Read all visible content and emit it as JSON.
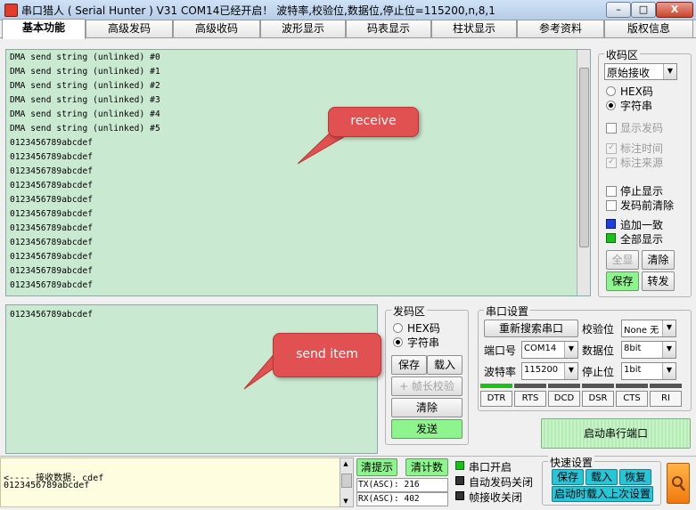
{
  "window": {
    "title": "串口猎人 ( Serial Hunter ) V31    COM14已经开启！ 波特率,校验位,数据位,停止位=115200,n,8,1",
    "minimize": "–",
    "maximize": "□",
    "close": "X"
  },
  "tabs": [
    "基本功能",
    "高级发码",
    "高级收码",
    "波形显示",
    "码表显示",
    "柱状显示",
    "参考资料",
    "版权信息"
  ],
  "receive": {
    "lines": [
      "DMA send string (unlinked) #0",
      "DMA send string (unlinked) #1",
      "DMA send string (unlinked) #2",
      "DMA send string (unlinked) #3",
      "DMA send string (unlinked) #4",
      "DMA send string (unlinked) #5",
      "0123456789abcdef",
      "0123456789abcdef",
      "0123456789abcdef",
      "0123456789abcdef",
      "0123456789abcdef",
      "0123456789abcdef",
      "0123456789abcdef",
      "0123456789abcdef",
      "0123456789abcdef",
      "0123456789abcdef",
      "0123456789abcdef"
    ],
    "callout": "receive"
  },
  "send": {
    "text": "0123456789abcdef",
    "callout": "send item"
  },
  "recv_zone": {
    "title": "收码区",
    "mode_select": "原始接收",
    "radio_hex": "HEX码",
    "radio_str": "字符串",
    "show_send": "显示发码",
    "mark_time": "标注时间",
    "mark_source": "标注来源",
    "stop_display": "停止显示",
    "clear_before_send": "发码前清除",
    "append": "追加一致",
    "show_all": "全部显示",
    "btn_all": "全显",
    "btn_clear": "清除",
    "btn_save": "保存",
    "btn_resend": "转发"
  },
  "send_zone": {
    "title": "发码区",
    "radio_hex": "HEX码",
    "radio_str": "字符串",
    "btn_save": "保存",
    "btn_load": "载入",
    "btn_frame": "+ 帧长校验",
    "btn_clear": "清除",
    "btn_send": "发送"
  },
  "port": {
    "title": "串口设置",
    "rescan": "重新搜索串口",
    "parity_label": "校验位",
    "parity_value": "None 无",
    "port_label": "端口号",
    "port_value": "COM14",
    "databits_label": "数据位",
    "databits_value": "8bit",
    "baud_label": "波特率",
    "baud_value": "115200",
    "stopbits_label": "停止位",
    "stopbits_value": "1bit",
    "signals": [
      "DTR",
      "RTS",
      "DCD",
      "DSR",
      "CTS",
      "RI"
    ],
    "signal_on": [
      true,
      false,
      false,
      false,
      false,
      false
    ],
    "start_button": "启动串行端口"
  },
  "status": {
    "text_line1": "<---- 接收数据: cdef",
    "text_line2": "0123456789abcdef",
    "clear_hint": "清提示",
    "clear_count": "清计数",
    "tx": "TX(ASC): 216",
    "rx": "RX(ASC): 402",
    "port_open": "串口开启",
    "auto_close": "自动发码关闭",
    "frame_close": "帧接收关闭",
    "quick_title": "快速设置",
    "quick_save": "保存",
    "quick_load": "载入",
    "quick_restore": "恢复",
    "quick_autoload": "启动时载入上次设置"
  },
  "icons": {
    "app": "app-icon",
    "tools": "tools-icon"
  },
  "colors": {
    "area_bg": "#c9e9d1",
    "green_button": "#8ef58e",
    "callout": "#e25151"
  }
}
